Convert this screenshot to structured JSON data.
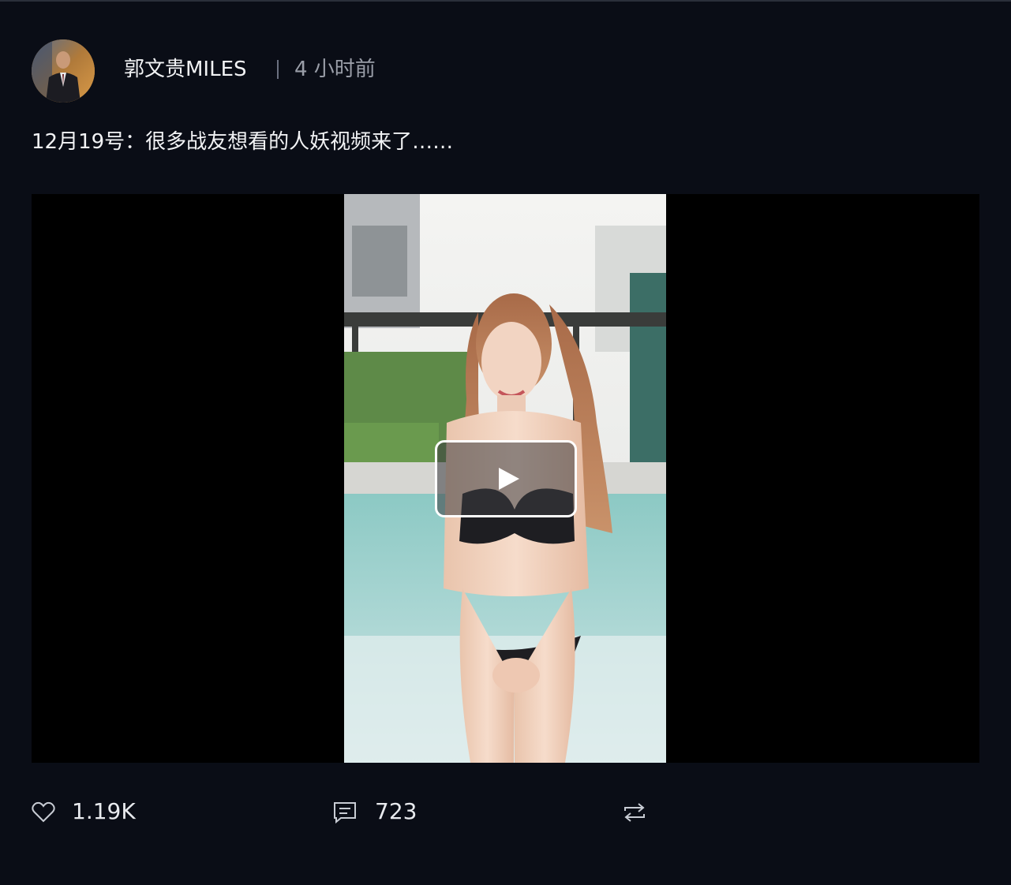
{
  "post": {
    "author_name": "郭文贵MILES",
    "time_ago": "4 小时前",
    "text": "12月19号：很多战友想看的人妖视频来了……"
  },
  "video": {
    "play_icon": "play-icon"
  },
  "actions": {
    "like_count": "1.19K",
    "comment_count": "723",
    "repost_icon": "repost-icon",
    "like_icon": "heart-icon",
    "comment_icon": "comment-icon"
  },
  "colors": {
    "background": "#0a0d16",
    "video_letterbox": "#000000",
    "text_primary": "#f2f3f5",
    "text_secondary": "#9a9ea8"
  }
}
